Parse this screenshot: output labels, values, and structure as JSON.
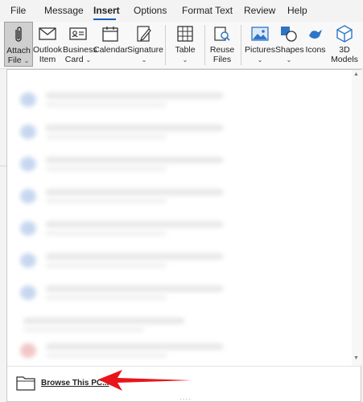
{
  "menu": {
    "tabs": [
      "File",
      "Message",
      "Insert",
      "Options",
      "Format Text",
      "Review",
      "Help"
    ],
    "active": "Insert"
  },
  "ribbon": {
    "buttons": [
      {
        "line1": "Attach",
        "line2": "File",
        "icon": "paperclip-icon",
        "dropdown": true,
        "selected": true
      },
      {
        "line1": "Outlook",
        "line2": "Item",
        "icon": "envelope-icon",
        "dropdown": false
      },
      {
        "line1": "Business",
        "line2": "Card",
        "icon": "business-card-icon",
        "dropdown": true
      },
      {
        "line1": "Calendar",
        "line2": "",
        "icon": "calendar-icon",
        "dropdown": false
      },
      {
        "line1": "Signature",
        "line2": "",
        "icon": "signature-pen-icon",
        "dropdown": true
      },
      {
        "line1": "Table",
        "line2": "",
        "icon": "table-icon",
        "dropdown": true
      },
      {
        "line1": "Reuse",
        "line2": "Files",
        "icon": "reuse-files-icon",
        "dropdown": false
      },
      {
        "line1": "Pictures",
        "line2": "",
        "icon": "pictures-icon",
        "dropdown": true
      },
      {
        "line1": "Shapes",
        "line2": "",
        "icon": "shapes-icon",
        "dropdown": true
      },
      {
        "line1": "Icons",
        "line2": "",
        "icon": "icons-bird-icon",
        "dropdown": false
      },
      {
        "line1": "3D",
        "line2": "Models",
        "icon": "cube-3d-icon",
        "dropdown": true
      }
    ]
  },
  "dropdown": {
    "browse_label": "Browse This PC...",
    "grip": "....",
    "recent_items_count_visible": 9
  },
  "colors": {
    "accent": "#185abd",
    "arrow": "#e8151b"
  }
}
